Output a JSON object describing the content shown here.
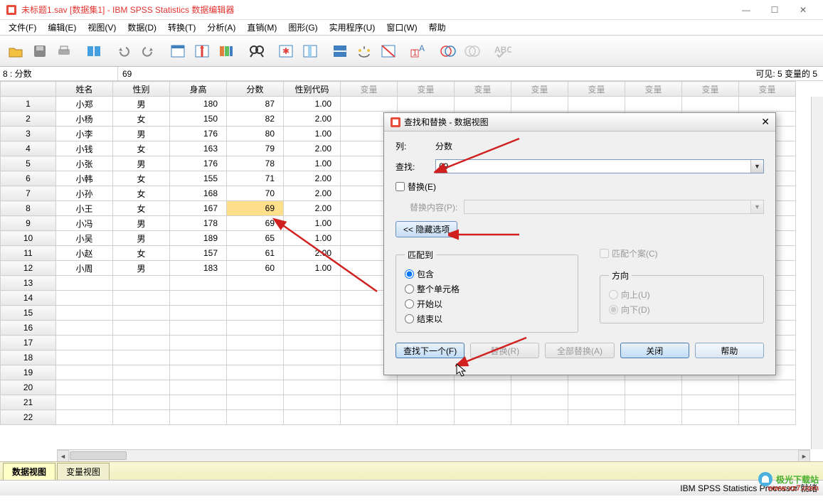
{
  "window": {
    "title": "未标题1.sav [数据集1] - IBM SPSS Statistics 数据编辑器"
  },
  "menu": [
    "文件(F)",
    "编辑(E)",
    "视图(V)",
    "数据(D)",
    "转换(T)",
    "分析(A)",
    "直销(M)",
    "图形(G)",
    "实用程序(U)",
    "窗口(W)",
    "帮助"
  ],
  "refbar": {
    "cell": "8 : 分数",
    "value": "69",
    "right": "可见: 5 变量的 5"
  },
  "columns": [
    "姓名",
    "性别",
    "身高",
    "分数",
    "性别代码"
  ],
  "empty_col": "变量",
  "rows": [
    {
      "n": "1",
      "姓名": "小郑",
      "性别": "男",
      "身高": "180",
      "分数": "87",
      "性别代码": "1.00"
    },
    {
      "n": "2",
      "姓名": "小杨",
      "性别": "女",
      "身高": "150",
      "分数": "82",
      "性别代码": "2.00"
    },
    {
      "n": "3",
      "姓名": "小李",
      "性别": "男",
      "身高": "176",
      "分数": "80",
      "性别代码": "1.00"
    },
    {
      "n": "4",
      "姓名": "小钱",
      "性别": "女",
      "身高": "163",
      "分数": "79",
      "性别代码": "2.00"
    },
    {
      "n": "5",
      "姓名": "小张",
      "性别": "男",
      "身高": "176",
      "分数": "78",
      "性别代码": "1.00"
    },
    {
      "n": "6",
      "姓名": "小韩",
      "性别": "女",
      "身高": "155",
      "分数": "71",
      "性别代码": "2.00"
    },
    {
      "n": "7",
      "姓名": "小孙",
      "性别": "女",
      "身高": "168",
      "分数": "70",
      "性别代码": "2.00"
    },
    {
      "n": "8",
      "姓名": "小王",
      "性别": "女",
      "身高": "167",
      "分数": "69",
      "性别代码": "2.00"
    },
    {
      "n": "9",
      "姓名": "小冯",
      "性别": "男",
      "身高": "178",
      "分数": "69",
      "性别代码": "1.00"
    },
    {
      "n": "10",
      "姓名": "小吴",
      "性别": "男",
      "身高": "189",
      "分数": "65",
      "性别代码": "1.00"
    },
    {
      "n": "11",
      "姓名": "小赵",
      "性别": "女",
      "身高": "157",
      "分数": "61",
      "性别代码": "2.00"
    },
    {
      "n": "12",
      "姓名": "小周",
      "性别": "男",
      "身高": "183",
      "分数": "60",
      "性别代码": "1.00"
    }
  ],
  "empty_rows": [
    "13",
    "14",
    "15",
    "16",
    "17",
    "18",
    "19",
    "20",
    "21",
    "22"
  ],
  "tabs": {
    "data_view": "数据视图",
    "var_view": "变量视图"
  },
  "status": {
    "processor": "IBM SPSS Statistics Processor 就绪"
  },
  "dialog": {
    "title": "查找和替换 - 数据视图",
    "col_label": "列:",
    "col_value": "分数",
    "find_label": "查找:",
    "find_value": "69",
    "replace_chk": "替换(E)",
    "replace_label": "替换内容(P):",
    "replace_value": "",
    "hide_opts": "<< 隐藏选项",
    "match_legend": "匹配到",
    "match_contain": "包含",
    "match_whole": "整个单元格",
    "match_start": "开始以",
    "match_end": "结束以",
    "match_case": "匹配个案(C)",
    "dir_legend": "方向",
    "dir_up": "向上(U)",
    "dir_down": "向下(D)",
    "btn_find_next": "查找下一个(F)",
    "btn_replace": "替换(R)",
    "btn_replace_all": "全部替换(A)",
    "btn_close": "关闭",
    "btn_help": "帮助"
  },
  "watermark": {
    "brand": "极光下载站",
    "url": "www.xz7.com"
  }
}
